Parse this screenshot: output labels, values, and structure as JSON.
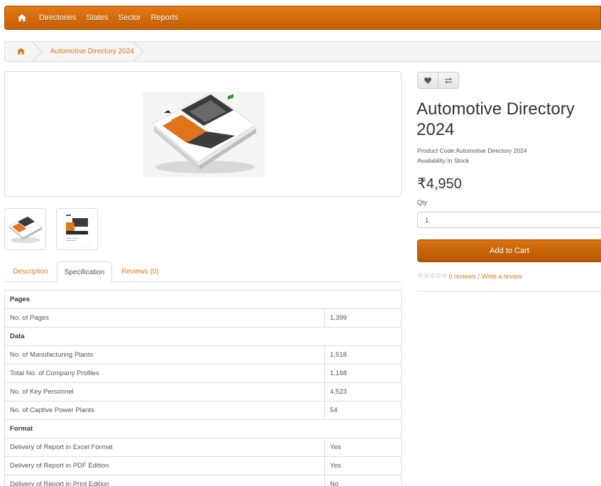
{
  "nav": {
    "home_icon": "home-icon",
    "items": [
      {
        "label": "Directories"
      },
      {
        "label": "States"
      },
      {
        "label": "Sector"
      },
      {
        "label": "Reports"
      }
    ]
  },
  "breadcrumb": {
    "home_icon": "home-icon",
    "items": [
      {
        "label": "Automotive Directory 2024"
      }
    ]
  },
  "product": {
    "title": "Automotive Directory 2024",
    "product_code_label": "Product Code:",
    "product_code": "Automotive Directory 2024",
    "availability_label": "Availability:",
    "availability": "In Stock",
    "price": "₹4,950",
    "qty_label": "Qty",
    "qty_value": "1",
    "add_to_cart": "Add to Cart",
    "reviews_link": "0 reviews",
    "write_review_link": "Write a review",
    "rating_stars": 0,
    "wishlist_icon": "heart-icon",
    "compare_icon": "exchange-icon"
  },
  "tabs": [
    {
      "label": "Description",
      "active": false
    },
    {
      "label": "Specification",
      "active": true
    },
    {
      "label": "Reviews (0)",
      "active": false
    }
  ],
  "specification": {
    "groups": [
      {
        "name": "Pages",
        "rows": [
          {
            "label": "No. of Pages",
            "value": "1,399"
          }
        ]
      },
      {
        "name": "Data",
        "rows": [
          {
            "label": "No. of Manufacturing Plants",
            "value": "1,518"
          },
          {
            "label": "Total No. of Company Profiles",
            "value": "1,168"
          },
          {
            "label": "No. of Key Personnel",
            "value": "4,523"
          },
          {
            "label": "No. of Captive Power Plants",
            "value": "54"
          }
        ]
      },
      {
        "name": "Format",
        "rows": [
          {
            "label": "Delivery of Report in Excel Format",
            "value": "Yes"
          },
          {
            "label": "Delivery of Report in PDF Edition",
            "value": "Yes"
          },
          {
            "label": "Delivery of Report in Print Edition",
            "value": "No"
          }
        ]
      }
    ]
  },
  "colors": {
    "accent": "#e07b1c",
    "navbar": "#d06a0c",
    "button": "#c8640a"
  }
}
